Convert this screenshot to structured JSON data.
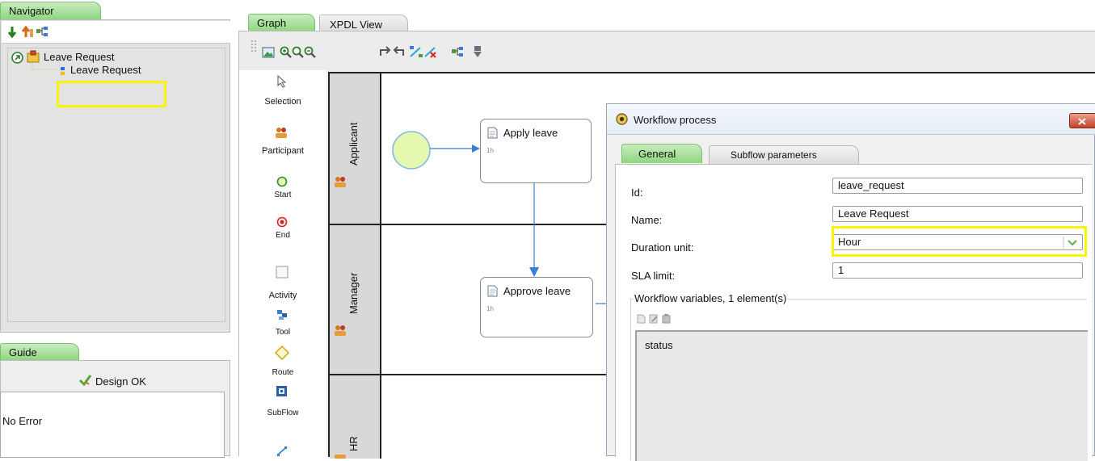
{
  "navigator": {
    "tab_label": "Navigator",
    "tree": {
      "root_label": "Leave Request",
      "child_label": "Leave Request"
    }
  },
  "guide": {
    "tab_label": "Guide",
    "status": "Design OK",
    "message": "No Error"
  },
  "graph_tabs": {
    "graph": "Graph",
    "xpdl": "XPDL View"
  },
  "palette": {
    "items": [
      "Selection",
      "Participant",
      "Start",
      "End",
      "Activity",
      "Tool",
      "Route",
      "SubFlow"
    ]
  },
  "lanes": [
    "Applicant",
    "Manager",
    "HR"
  ],
  "activities": [
    {
      "name": "Apply leave",
      "duration": "1h"
    },
    {
      "name": "Approve leave",
      "duration": "1h"
    }
  ],
  "dialog": {
    "title": "Workflow process",
    "tabs": [
      "General",
      "Subflow parameters"
    ],
    "fields": {
      "id_label": "Id:",
      "id_value": "leave_request",
      "name_label": "Name:",
      "name_value": "Leave Request",
      "duration_label": "Duration unit:",
      "duration_value": "Hour",
      "sla_label": "SLA limit:",
      "sla_value": "1"
    },
    "variables_legend": "Workflow variables, 1 element(s)",
    "variables": [
      "status"
    ]
  },
  "colors": {
    "highlight": "#fff400",
    "tab_green": "#8fd67e",
    "start_event": "#e4f8b0"
  }
}
